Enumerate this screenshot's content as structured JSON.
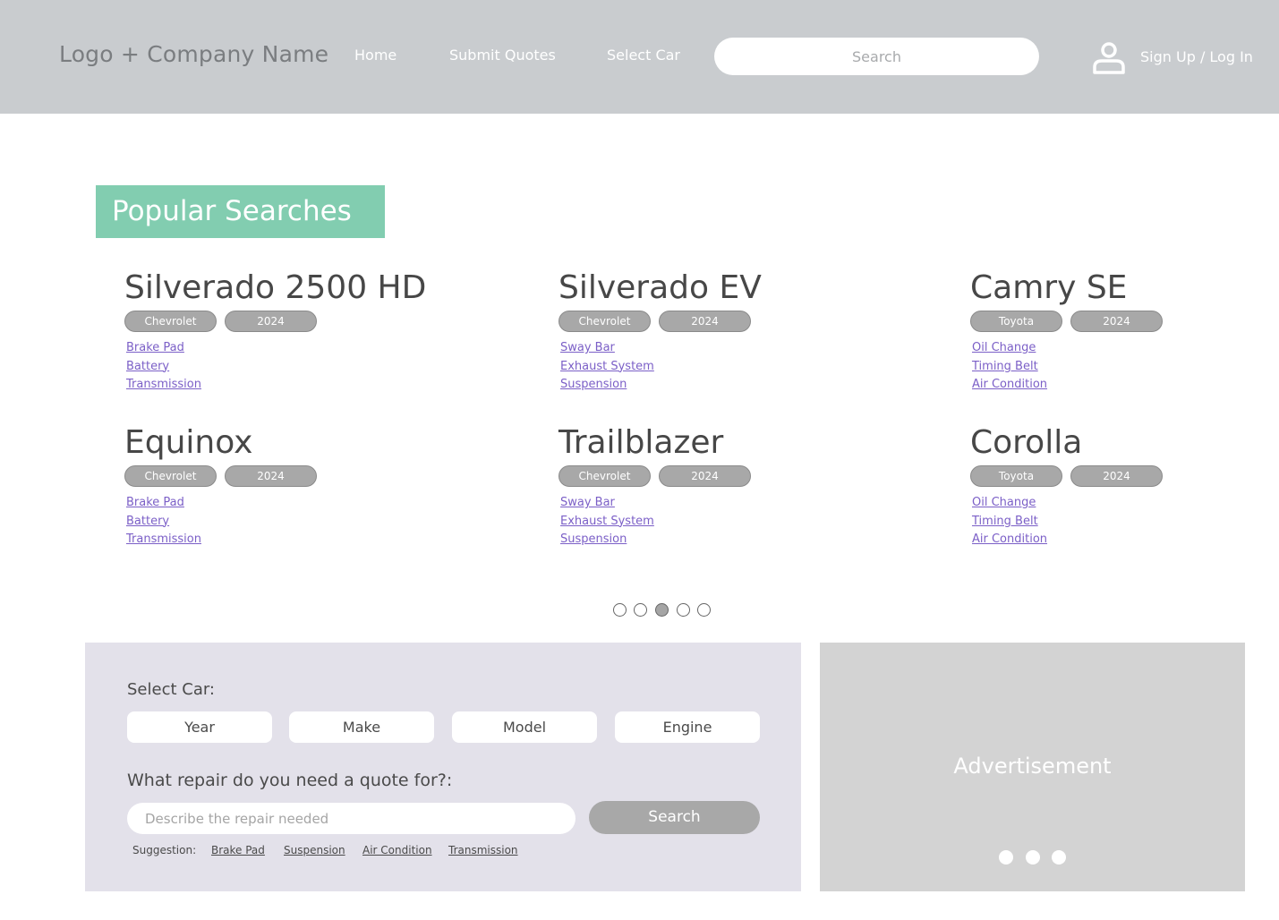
{
  "header": {
    "logo": "Logo + Company Name",
    "nav": [
      "Home",
      "Submit Quotes",
      "Select Car"
    ],
    "search_placeholder": "Search",
    "account": "Sign Up / Log In",
    "account_icon": "user-icon"
  },
  "popular": {
    "title": "Popular Searches",
    "cards": [
      {
        "name": "Silverado 2500 HD",
        "make": "Chevrolet",
        "year": "2024",
        "repairs": [
          "Brake Pad",
          "Battery",
          "Transmission"
        ]
      },
      {
        "name": "Silverado EV",
        "make": "Chevrolet",
        "year": "2024",
        "repairs": [
          "Sway Bar",
          "Exhaust System",
          "Suspension"
        ]
      },
      {
        "name": "Camry SE",
        "make": "Toyota",
        "year": "2024",
        "repairs": [
          "Oil Change",
          "Timing Belt",
          "Air Condition"
        ]
      },
      {
        "name": "Equinox",
        "make": "Chevrolet",
        "year": "2024",
        "repairs": [
          "Brake Pad",
          "Battery",
          "Transmission"
        ]
      },
      {
        "name": "Trailblazer",
        "make": "Chevrolet",
        "year": "2024",
        "repairs": [
          "Sway Bar",
          "Exhaust System",
          "Suspension"
        ]
      },
      {
        "name": "Corolla",
        "make": "Toyota",
        "year": "2024",
        "repairs": [
          "Oil Change",
          "Timing Belt",
          "Air Condition"
        ]
      }
    ],
    "carousel": {
      "count": 5,
      "active_index": 2
    }
  },
  "quote": {
    "select_label": "Select Car:",
    "selects": [
      "Year",
      "Make",
      "Model",
      "Engine"
    ],
    "repair_label": "What repair do you need a quote for?:",
    "repair_placeholder": "Describe the repair needed",
    "search_label": "Search",
    "suggestion_label": "Suggestion:",
    "suggestions": [
      "Brake Pad",
      "Suspension",
      "Air Condition",
      "Transmission"
    ]
  },
  "ad": {
    "label": "Advertisement",
    "dots": 3
  },
  "colors": {
    "header_bg": "#c9cccf",
    "accent": "#82cdb0",
    "link": "#7b5fc7",
    "panel_bg": "#e3e1ea",
    "ad_bg": "#d3d3d3",
    "pill": "#a8a8a8"
  }
}
